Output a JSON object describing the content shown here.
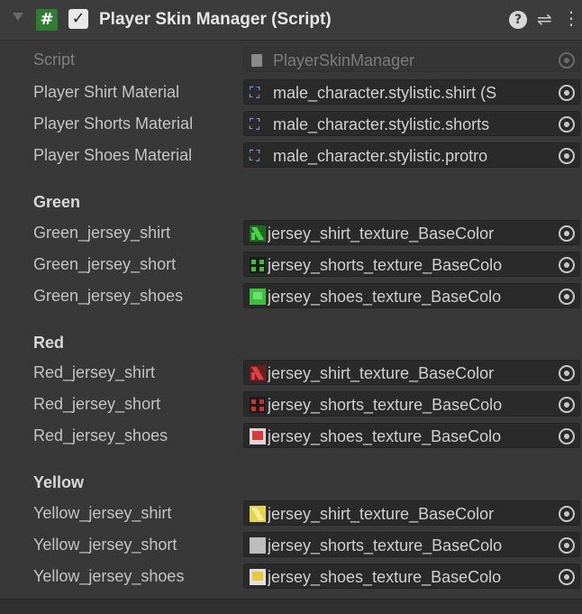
{
  "header": {
    "title": "Player Skin Manager (Script)",
    "enabled": true,
    "icons": [
      "fold-arrow-icon",
      "script-hash-icon",
      "checkbox-icon",
      "help-icon",
      "preset-icon",
      "kebab-menu-icon"
    ],
    "script_icon_glyph": "#",
    "check_glyph": "✓",
    "help_glyph": "?",
    "preset_glyph": "⇌",
    "menu_glyph": "⋮"
  },
  "fields": {
    "script": {
      "label": "Script",
      "value": "PlayerSkinManager"
    },
    "shirt_material": {
      "label": "Player Shirt Material",
      "value": "male_character.stylistic.shirt (S"
    },
    "shorts_material": {
      "label": "Player Shorts Material",
      "value": "male_character.stylistic.shorts"
    },
    "shoes_material": {
      "label": "Player Shoes Material",
      "value": "male_character.stylistic.protro"
    }
  },
  "material_glyph": "⛶",
  "sections": {
    "green": {
      "title": "Green",
      "shirt": {
        "label": "Green_jersey_shirt",
        "value": "jersey_shirt_texture_BaseColor"
      },
      "short": {
        "label": "Green_jersey_short",
        "value": "jersey_shorts_texture_BaseColo"
      },
      "shoes": {
        "label": "Green_jersey_shoes",
        "value": "jersey_shoes_texture_BaseColo"
      },
      "color": "#3fbf3f"
    },
    "red": {
      "title": "Red",
      "shirt": {
        "label": "Red_jersey_shirt",
        "value": "jersey_shirt_texture_BaseColor"
      },
      "short": {
        "label": "Red_jersey_short",
        "value": "jersey_shorts_texture_BaseColo"
      },
      "shoes": {
        "label": "Red_jersey_shoes",
        "value": "jersey_shoes_texture_BaseColo"
      },
      "color": "#d63a3a"
    },
    "yellow": {
      "title": "Yellow",
      "shirt": {
        "label": "Yellow_jersey_shirt",
        "value": "jersey_shirt_texture_BaseColor"
      },
      "short": {
        "label": "Yellow_jersey_short",
        "value": "jersey_shorts_texture_BaseColo"
      },
      "shoes": {
        "label": "Yellow_jersey_shoes",
        "value": "jersey_shoes_texture_BaseColo"
      },
      "color": "#e6d44a"
    }
  }
}
